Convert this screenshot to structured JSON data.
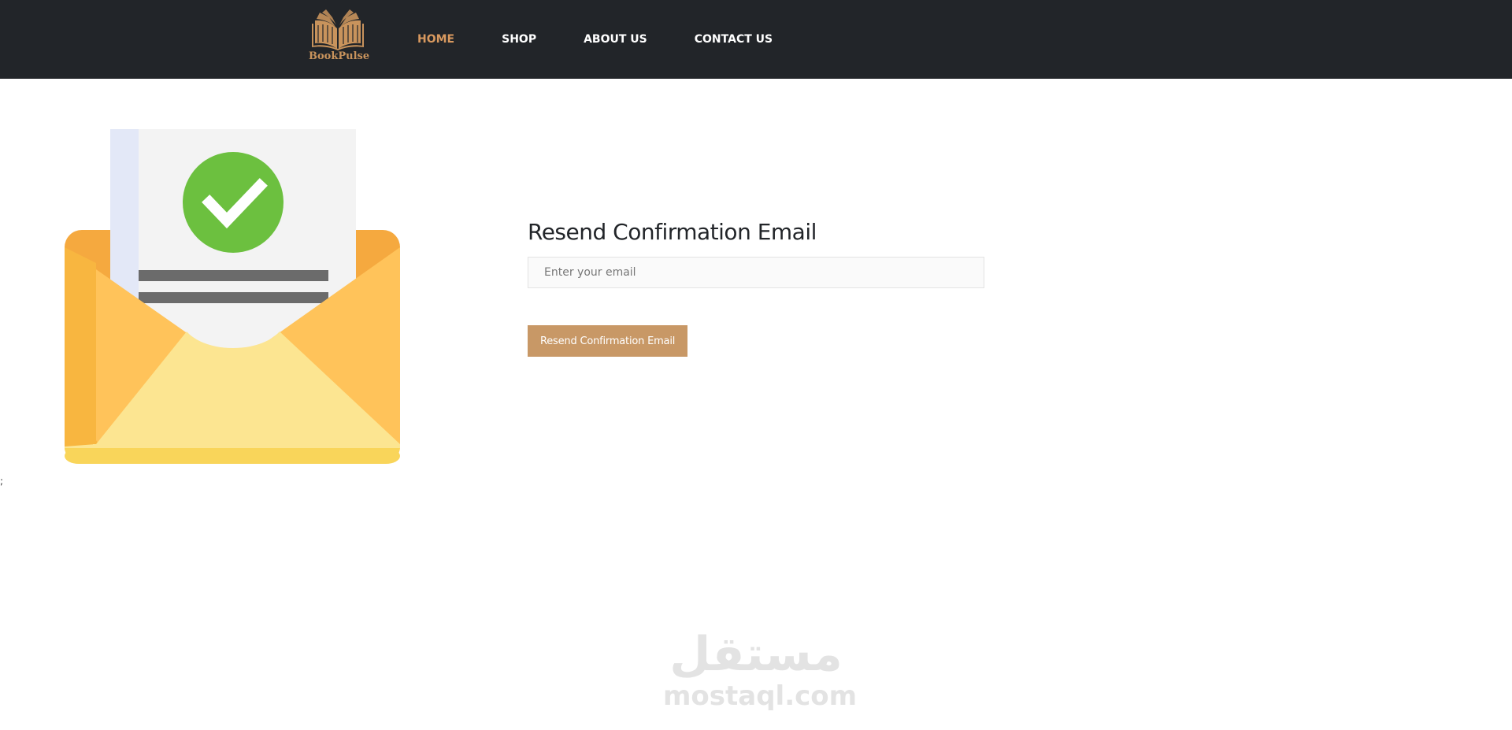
{
  "brand": {
    "name": "BookPulse",
    "color": "#c8935c",
    "icon": "open-book-icon"
  },
  "nav": {
    "items": [
      {
        "label": "HOME",
        "active": true
      },
      {
        "label": "SHOP",
        "active": false
      },
      {
        "label": "ABOUT US",
        "active": false
      },
      {
        "label": "CONTACT US",
        "active": false
      }
    ],
    "active_color": "#d8995f",
    "background": "#222529"
  },
  "illustration": {
    "icon": "email-confirmed-envelope-icon",
    "check_color": "#6cc03f",
    "envelope_color": "#fec35a"
  },
  "stray_mark": ";",
  "form": {
    "title": "Resend Confirmation Email",
    "email_placeholder": "Enter your email",
    "email_value": "",
    "submit_label": "Resend Confirmation Email",
    "button_color": "#c89866"
  },
  "watermark": {
    "arabic": "مستقل",
    "latin": "mostaql.com"
  }
}
